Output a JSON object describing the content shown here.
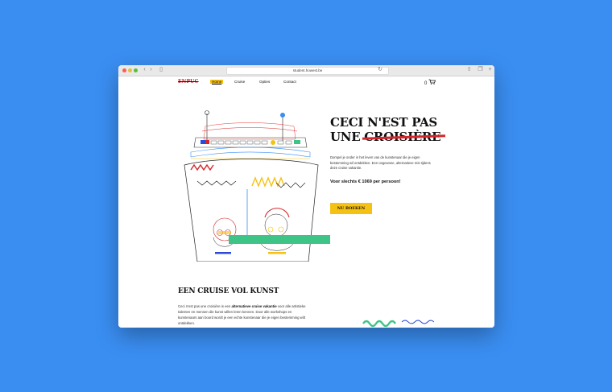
{
  "browser": {
    "url": "student.howest.be"
  },
  "site": {
    "logo": "ENPUC",
    "nav": [
      "Home",
      "Cruise",
      "Opties",
      "Contact"
    ],
    "cart_count": "0"
  },
  "hero": {
    "title_line1": "CECI N'EST PAS",
    "title_line2_prefix": "UNE",
    "title_line2_struck": "CROISIÈRE",
    "text": "Dompel je onder in het leven van de kunstenaar die je eigen bestemming wil ontdekken. Een ongewone, alternatieve reis tijdens deze cruise vakantie.",
    "price": "Voor slechts € 1069 per persoon!",
    "cta": "NU BOEKEN"
  },
  "section": {
    "title": "EEN CRUISE VOL KUNST",
    "text_prefix": "Ceci n'est pas une croisière is een",
    "text_bold": "alternatieve cruise vakantie",
    "text_suffix": "voor alle artistieke talenten en mensen die kunst willen leren kennen. Door alle workshops en kunstenaars aan boord wordt je een echte kunstenaar die je eigen bestemming wilt ontdekken."
  },
  "colors": {
    "background": "#3a8ef2",
    "accent_yellow": "#f5c214",
    "accent_red": "#d4262b",
    "accent_green": "#3ec486"
  }
}
